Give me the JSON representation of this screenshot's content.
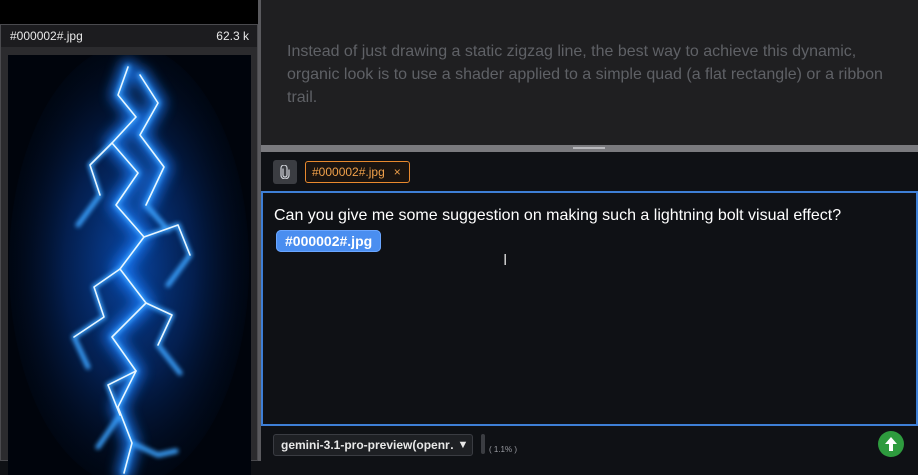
{
  "file_panel": {
    "file_name": "#000002#.jpg",
    "file_size": "62.3 k"
  },
  "previous_message": {
    "text": "Instead of just drawing a static zigzag line, the best way to achieve this dynamic, organic look is to use a shader applied to a simple quad (a flat rectangle) or a ribbon trail."
  },
  "composer": {
    "attach_icon": "paperclip-icon",
    "attachment_chip": "#000002#.jpg",
    "chip_close": "×",
    "message_text": "Can you give me some suggestion on making such a lightning bolt visual effect?",
    "inline_file_tag": "#000002#.jpg",
    "model_label": "gemini-3.1-pro-preview(openr…",
    "model_caret": "▼",
    "usage": "( 1.1% )",
    "send_icon": "up-arrow-icon"
  },
  "colors": {
    "editor_border": "#3e7fd6",
    "chip_border": "#e8892e",
    "inline_chip_bg": "#4a8ef0",
    "send_button": "#2e9b3e",
    "lightning": "#49b4ff"
  }
}
